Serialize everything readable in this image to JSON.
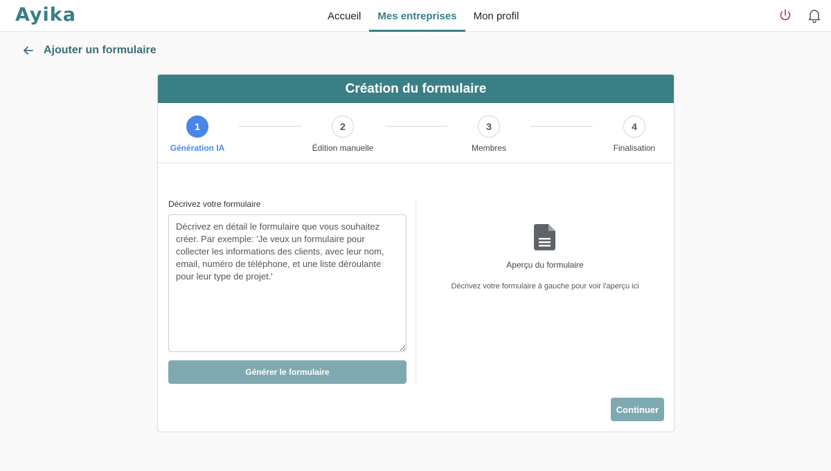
{
  "app": {
    "logo": "Ayika"
  },
  "nav": {
    "items": [
      {
        "label": "Accueil",
        "active": false
      },
      {
        "label": "Mes entreprises",
        "active": true
      },
      {
        "label": "Mon profil",
        "active": false
      }
    ]
  },
  "header_icons": {
    "power": "power-icon",
    "notifications": "bell-icon"
  },
  "page": {
    "back_icon": "arrow-left-icon",
    "title": "Ajouter un formulaire"
  },
  "card": {
    "title": "Création du formulaire",
    "steps": [
      {
        "number": "1",
        "label": "Génération IA",
        "active": true
      },
      {
        "number": "2",
        "label": "Édition manuelle",
        "active": false
      },
      {
        "number": "3",
        "label": "Membres",
        "active": false
      },
      {
        "number": "4",
        "label": "Finalisation",
        "active": false
      }
    ],
    "form": {
      "label": "Décrivez votre formulaire",
      "value": "",
      "placeholder": "Décrivez en détail le formulaire que vous souhaitez créer. Par exemple: 'Je veux un formulaire pour collecter les informations des clients, avec leur nom, email, numéro de téléphone, et une liste déroulante pour leur type de projet.'",
      "generate_label": "Générer le formulaire"
    },
    "preview": {
      "icon": "document-icon",
      "title": "Aperçu du formulaire",
      "hint": "Décrivez votre formulaire à gauche pour voir l'aperçu ici"
    },
    "continue_label": "Continuer"
  },
  "colors": {
    "brand": "#3a7e86",
    "active_step": "#4a86e8",
    "disabled_button": "#7fa9b0",
    "power_icon": "#b0374a"
  }
}
